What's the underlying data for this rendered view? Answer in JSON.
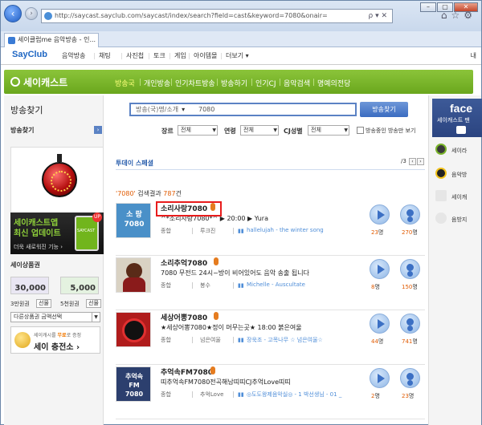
{
  "browser": {
    "url": "http://saycast.sayclub.com/saycast/index/search?field=cast&keyword=7080&onair=",
    "tab_title": "세이클럽me 음악방송 - 인...",
    "addr_controls": "ρ ▾ ✕",
    "win_min": "–",
    "win_max": "▢",
    "win_close": "✕",
    "tool_icons": "⌂☆⚙"
  },
  "sayclub": {
    "logo": "SayClub",
    "menu": [
      "음악방송",
      "채팅",
      "사진첩",
      "토크",
      "게임",
      "아이템몰",
      "더보기 ▾"
    ],
    "right_label": "내"
  },
  "saycast": {
    "logo": "세이캐스트",
    "menu": [
      "방송국",
      "개인방송",
      "인기차트방송",
      "방송하기",
      "인기CJ",
      "음악검색",
      "명예의전당"
    ]
  },
  "left": {
    "title": "방송찾기",
    "subtitle": "방송찾기",
    "sub_btn": "›",
    "ad_line1": "세이캐스트앱",
    "ad_line2": "최신 업데이트",
    "ad_line3": "더욱 새로워진 기능 ›",
    "ad_phone": "SAYCAST",
    "ad_badge": "UP",
    "voucher_title": "세이상품권",
    "vouchers": [
      {
        "amount": "30,000",
        "label": "3만원권",
        "btn": "선물"
      },
      {
        "amount": "5,000",
        "label": "5천원권",
        "btn": "선물"
      }
    ],
    "gift_select": "다른상품권 금액선택",
    "charge_line1_prefix": "세이캐시를 ",
    "charge_line1_hl": "무료",
    "charge_line1_suffix": "로 증정",
    "charge_line2": "세이 충전소 ›"
  },
  "search": {
    "select_label": "방송(국)명/소개",
    "select_arrow": "▾",
    "keyword": "7080",
    "button": "방송찾기",
    "filters": [
      {
        "label": "장르",
        "value": "전체"
      },
      {
        "label": "연령",
        "value": "전체"
      },
      {
        "label": "CJ성별",
        "value": "전체"
      }
    ],
    "onair_label": "방송중인 방송만 보기"
  },
  "today": {
    "title": "투데이 스페셜",
    "pager": "/3",
    "prev": "‹",
    "next": "›"
  },
  "result_count": {
    "keyword": "'7080'",
    "mid": " 검색결과 ",
    "count": "787",
    "suffix": "건"
  },
  "results": [
    {
      "title": "소리사랑7080",
      "desc": "^*소리사랑7080*^ ▶ 20:00 ▶ Yura",
      "genre": "종합",
      "cj": "루크진",
      "song": "hallelujah - the winter song",
      "listeners": "23",
      "fans": "270",
      "thumb_text": "소 랑 7080",
      "thumb_color": "#4a90c8"
    },
    {
      "title": "소리추억7080",
      "desc": "7080 무전드 24시~방이 비어있어도 음악 송출 됩니다",
      "genre": "종합",
      "cj": "봉수",
      "song": "Michelle - Auscultate",
      "listeners": "8",
      "fans": "150",
      "thumb_text": "",
      "thumb_color": "#d9d2c3"
    },
    {
      "title": "세상어뽕7080",
      "desc": "★세상어뽕7080★정이 머무는곳★ 18:00 붉은여울",
      "genre": "종합",
      "cj": "넘은여울",
      "song": "장욱조 - 고목나무 ☆ 넘은여울☆",
      "listeners": "44",
      "fans": "741",
      "thumb_text": "",
      "thumb_color": "#b01c1c"
    },
    {
      "title": "추억속FM7080",
      "desc": "띠추억속FM7080전곡해남띠띠CJ추억Love띠띠",
      "genre": "종합",
      "cj": "추억Love",
      "song": "◎도도왕제음악실◎ - 1 박선생님 - 01 _",
      "listeners": "2",
      "fans": "23",
      "thumb_text": "추억속 FM 7080",
      "thumb_color": "#2c3f6e"
    }
  ],
  "units": {
    "listener": "명",
    "fan": "명"
  },
  "right": {
    "fb_title": "face",
    "fb_sub": "세이캐스트 팬",
    "items": [
      "세이라",
      "음악방",
      "세이캐",
      "음방지"
    ]
  },
  "colors": {
    "green": "#7ab52a",
    "blue": "#2a5fad",
    "orange": "#e05a00",
    "red_highlight": "#e81c1c"
  }
}
